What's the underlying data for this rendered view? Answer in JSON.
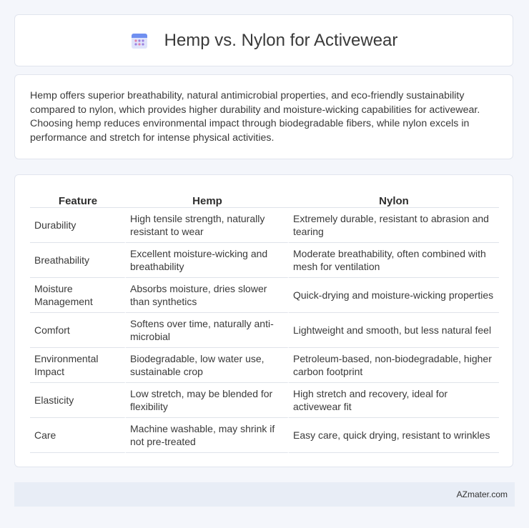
{
  "header": {
    "title": "Hemp vs. Nylon for Activewear",
    "icon": "calendar-grid-icon"
  },
  "summary": {
    "text": "Hemp offers superior breathability, natural antimicrobial properties, and eco-friendly sustainability compared to nylon, which provides higher durability and moisture-wicking capabilities for activewear. Choosing hemp reduces environmental impact through biodegradable fibers, while nylon excels in performance and stretch for intense physical activities."
  },
  "table": {
    "headers": [
      "Feature",
      "Hemp",
      "Nylon"
    ],
    "rows": [
      [
        "Durability",
        "High tensile strength, naturally resistant to wear",
        "Extremely durable, resistant to abrasion and tearing"
      ],
      [
        "Breathability",
        "Excellent moisture-wicking and breathability",
        "Moderate breathability, often combined with mesh for ventilation"
      ],
      [
        "Moisture Management",
        "Absorbs moisture, dries slower than synthetics",
        "Quick-drying and moisture-wicking properties"
      ],
      [
        "Comfort",
        "Softens over time, naturally anti-microbial",
        "Lightweight and smooth, but less natural feel"
      ],
      [
        "Environmental Impact",
        "Biodegradable, low water use, sustainable crop",
        "Petroleum-based, non-biodegradable, higher carbon footprint"
      ],
      [
        "Elasticity",
        "Low stretch, may be blended for flexibility",
        "High stretch and recovery, ideal for activewear fit"
      ],
      [
        "Care",
        "Machine washable, may shrink if not pre-treated",
        "Easy care, quick drying, resistant to wrinkles"
      ]
    ]
  },
  "footer": {
    "text": "AZmater.com"
  },
  "colors": {
    "background": "#f4f6fb",
    "card": "#ffffff",
    "footer_bg": "#e8edf6",
    "icon_blue": "#5b8def",
    "icon_purple": "#9b7fe0"
  }
}
